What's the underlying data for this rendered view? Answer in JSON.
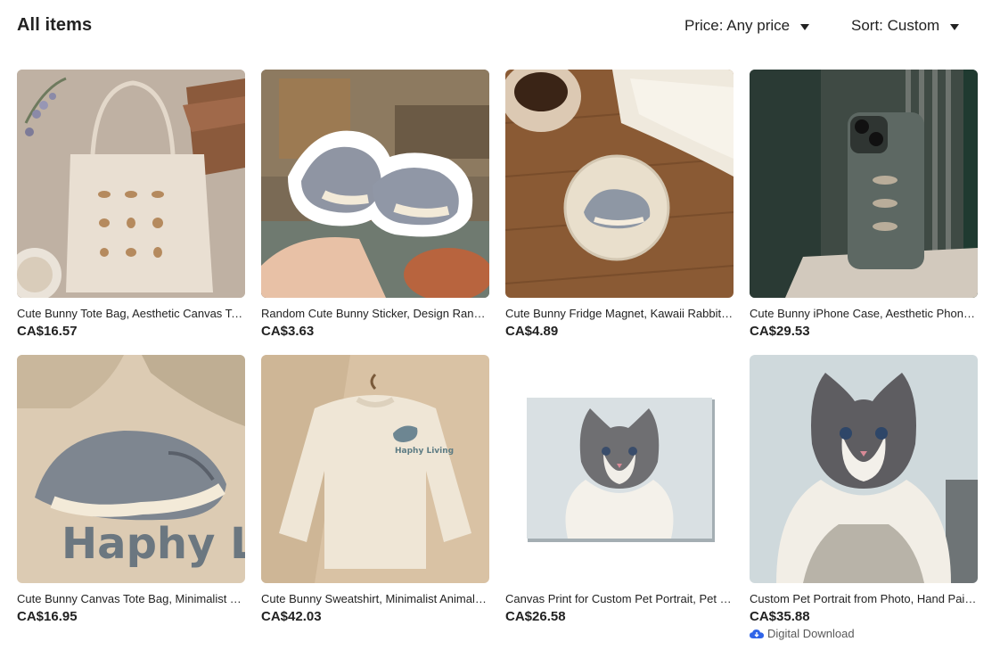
{
  "header": {
    "title": "All items",
    "price_filter": "Price: Any price",
    "sort_filter": "Sort: Custom"
  },
  "items": [
    {
      "title": "Cute Bunny Tote Bag, Aesthetic Canvas Tote Bag",
      "price": "CA$16.57",
      "image": "tote-bag-photo"
    },
    {
      "title": "Random Cute Bunny Sticker, Design Random Sticker",
      "price": "CA$3.63",
      "image": "sticker-photo"
    },
    {
      "title": "Cute Bunny Fridge Magnet, Kawaii Rabbit Magnet",
      "price": "CA$4.89",
      "image": "magnet-photo"
    },
    {
      "title": "Cute Bunny iPhone Case, Aesthetic Phone Case",
      "price": "CA$29.53",
      "image": "phone-case-photo"
    },
    {
      "title": "Cute Bunny Canvas Tote Bag, Minimalist Tote",
      "price": "CA$16.95",
      "image": "haphy-living-tote-photo",
      "print_text": "Haphy Living"
    },
    {
      "title": "Cute Bunny Sweatshirt, Minimalist Animal Sweatshirt",
      "price": "CA$42.03",
      "image": "sweatshirt-photo",
      "print_text": "Haphy Living"
    },
    {
      "title": "Canvas Print for Custom Pet Portrait, Pet Painting",
      "price": "CA$26.58",
      "image": "canvas-print-photo"
    },
    {
      "title": "Custom Pet Portrait from Photo, Hand Painted Portrait",
      "price": "CA$35.88",
      "image": "cat-portrait-photo",
      "badge": "Digital Download"
    }
  ],
  "colors": {
    "text": "#222222",
    "muted": "#595959",
    "badge_icon": "#2f64e8"
  }
}
